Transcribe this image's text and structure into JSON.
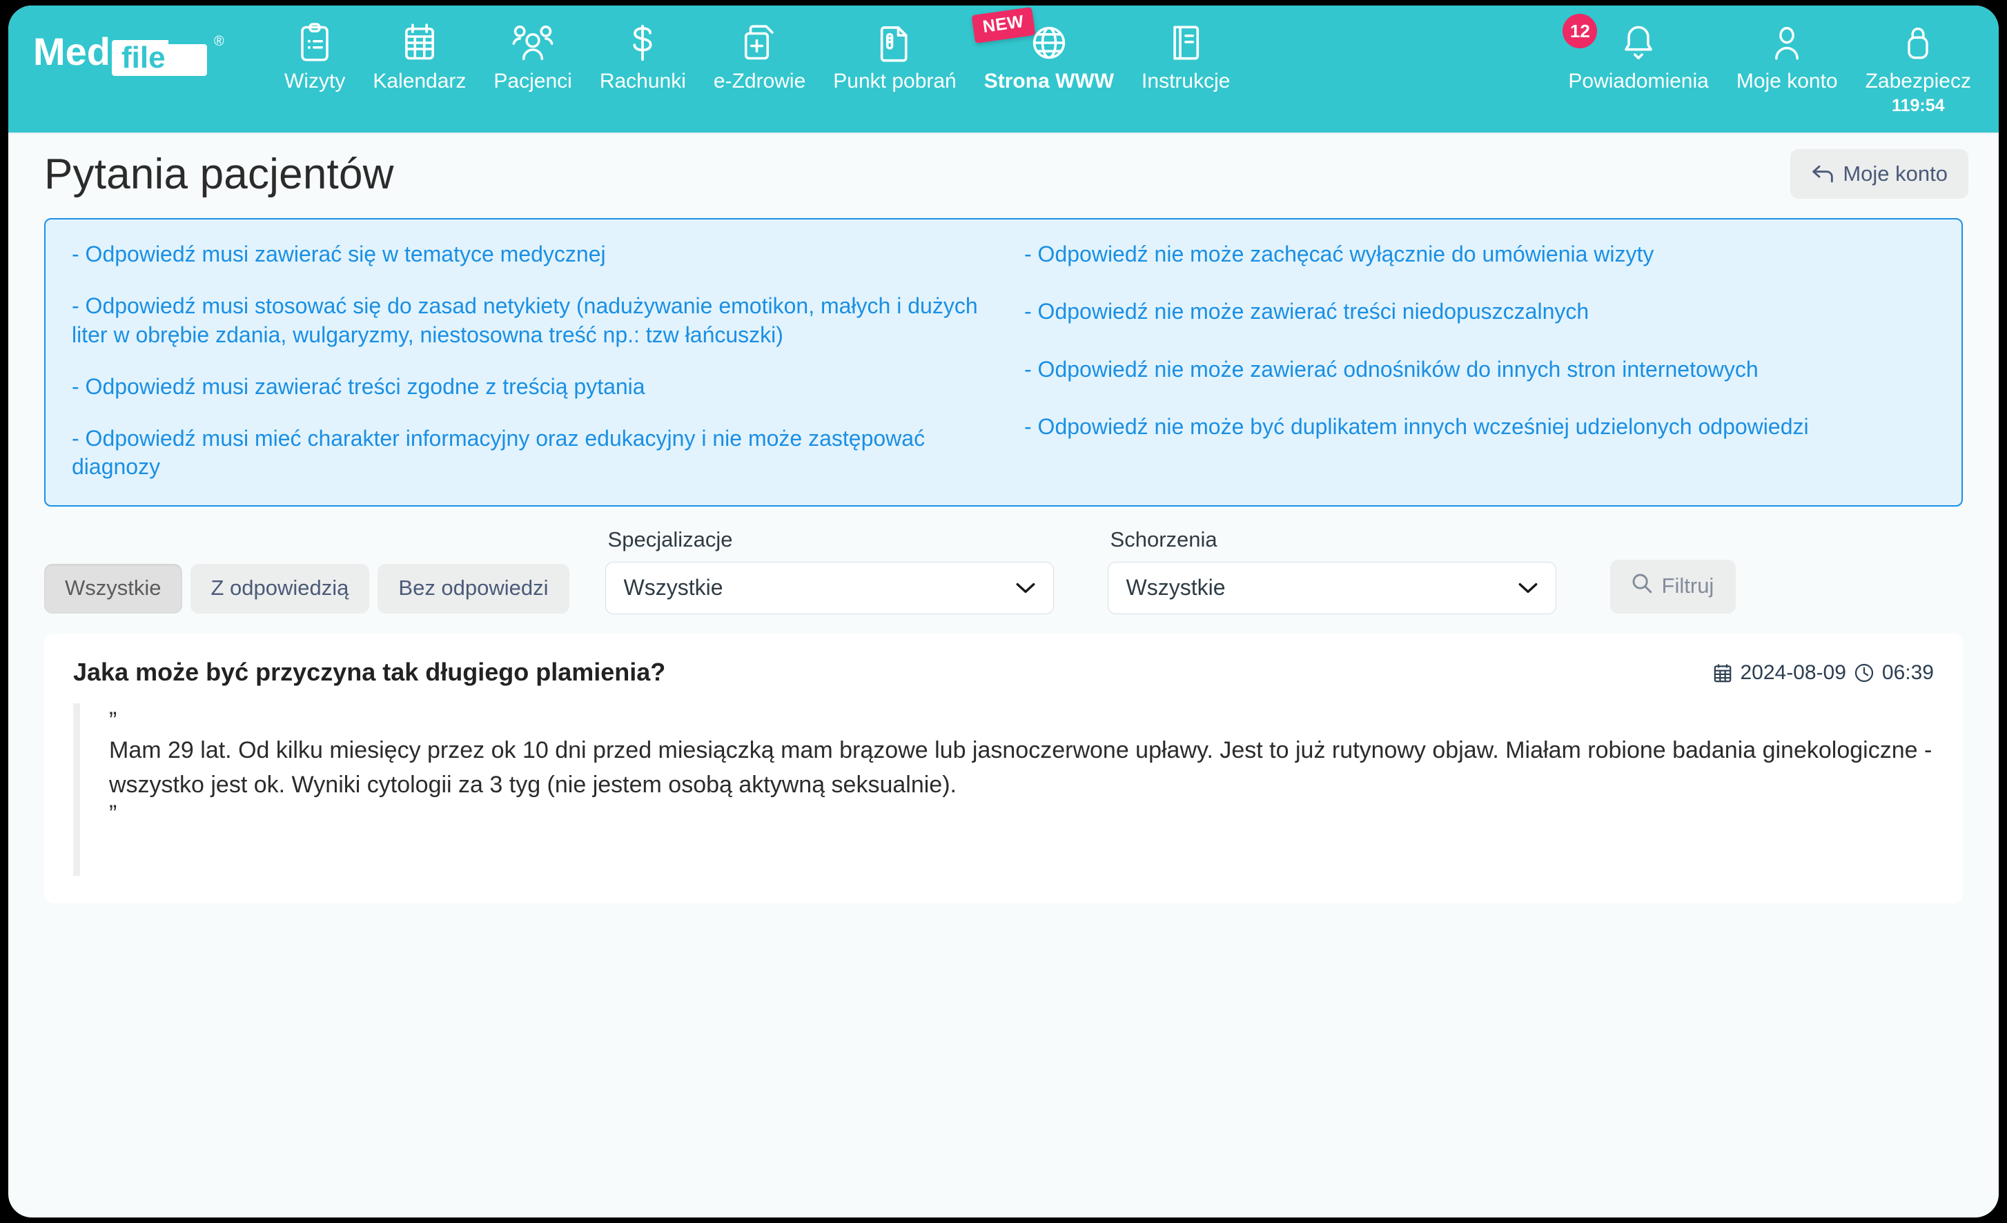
{
  "brand": {
    "name": "Med",
    "name2": "file",
    "trademark": "®"
  },
  "nav": {
    "items": [
      {
        "label": "Wizyty",
        "icon": "clipboard-list-icon"
      },
      {
        "label": "Kalendarz",
        "icon": "calendar-icon"
      },
      {
        "label": "Pacjenci",
        "icon": "users-icon"
      },
      {
        "label": "Rachunki",
        "icon": "dollar-icon"
      },
      {
        "label": "e-Zdrowie",
        "icon": "medical-files-icon"
      },
      {
        "label": "Punkt pobrań",
        "icon": "document-test-icon"
      },
      {
        "label": "Strona WWW",
        "icon": "globe-icon",
        "badge": "NEW"
      },
      {
        "label": "Instrukcje",
        "icon": "book-icon"
      }
    ],
    "right": [
      {
        "label": "Powiadomienia",
        "icon": "bell-icon",
        "count": "12"
      },
      {
        "label": "Moje konto",
        "icon": "user-icon"
      },
      {
        "label": "Zabezpiecz",
        "icon": "lock-icon",
        "sub": "119:54"
      }
    ]
  },
  "header": {
    "title": "Pytania pacjentów",
    "account_button": "Moje konto",
    "account_button_icon": "arrow-back-icon"
  },
  "rules": {
    "left": [
      "- Odpowiedź musi zawierać się w tematyce medycznej",
      "- Odpowiedź musi stosować się do zasad netykiety (nadużywanie emotikon, małych i dużych liter w obrębie zdania, wulgaryzmy, niestosowna treść np.: tzw łańcuszki)",
      "- Odpowiedź musi zawierać treści zgodne z treścią pytania",
      "- Odpowiedź musi mieć charakter informacyjny oraz edukacyjny i nie może zastępować diagnozy"
    ],
    "right": [
      "- Odpowiedź nie może zachęcać wyłącznie do umówienia wizyty",
      "- Odpowiedź nie może zawierać treści niedopuszczalnych",
      "- Odpowiedź nie może zawierać odnośników do innych stron internetowych",
      "- Odpowiedź nie może być duplikatem innych wcześniej udzielonych odpowiedzi"
    ]
  },
  "filters": {
    "tabs": [
      {
        "label": "Wszystkie",
        "active": true
      },
      {
        "label": "Z odpowiedzią",
        "active": false
      },
      {
        "label": "Bez odpowiedzi",
        "active": false
      }
    ],
    "specializations": {
      "label": "Specjalizacje",
      "value": "Wszystkie"
    },
    "conditions": {
      "label": "Schorzenia",
      "value": "Wszystkie"
    },
    "filter_button": {
      "label": "Filtruj",
      "icon": "search-icon"
    }
  },
  "question": {
    "title": "Jaka może być przyczyna tak długiego plamienia?",
    "date": "2024-08-09",
    "time": "06:39",
    "date_icon": "calendar-icon",
    "time_icon": "clock-icon",
    "open_quote": "”",
    "close_quote": "”",
    "body": "Mam 29 lat. Od kilku miesięcy przez ok 10 dni przed miesiączką mam brązowe lub jasnoczerwone upławy. Jest to już rutynowy objaw. Miałam robione badania ginekologiczne - wszystko jest ok. Wyniki cytologii za 3 tyg (nie jestem osobą aktywną seksualnie)."
  },
  "colors": {
    "brand_teal": "#33c6ce",
    "accent_pink": "#ed2a63",
    "info_blue": "#1a8fe3",
    "info_bg": "#e2f3fd",
    "page_bg": "#f7fbfc"
  }
}
